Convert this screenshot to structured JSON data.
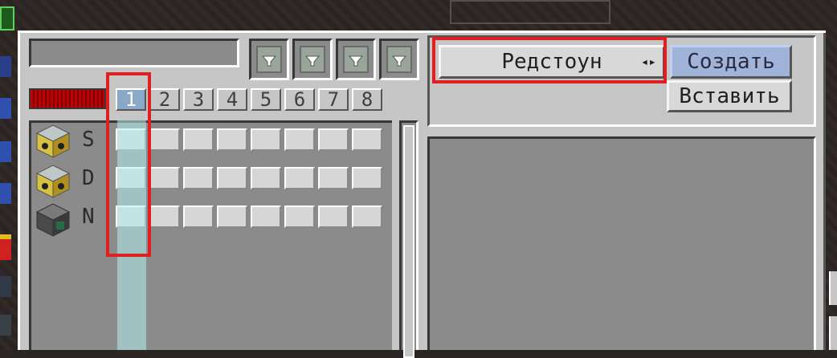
{
  "name_field": {
    "value": ""
  },
  "tabs": [
    {
      "label": "1",
      "active": true
    },
    {
      "label": "2",
      "active": false
    },
    {
      "label": "3",
      "active": false
    },
    {
      "label": "4",
      "active": false
    },
    {
      "label": "5",
      "active": false
    },
    {
      "label": "6",
      "active": false
    },
    {
      "label": "7",
      "active": false
    },
    {
      "label": "8",
      "active": false
    }
  ],
  "rows": [
    {
      "letter": "S",
      "icon": "reactor-block-icon"
    },
    {
      "letter": "D",
      "icon": "reactor-block-icon"
    },
    {
      "letter": "N",
      "icon": "network-block-icon"
    }
  ],
  "mode_button": {
    "label": "Редстоун",
    "arrows": "◂▸"
  },
  "create_button": {
    "label": "Создать"
  },
  "paste_button": {
    "label": "Вставить"
  },
  "colors": {
    "panel": "#c6c6c6",
    "slot_dark": "#8b8b8b",
    "highlight_box": "#e02020",
    "active_tab": "#8aa8c8",
    "power_bar": "#c00000"
  }
}
